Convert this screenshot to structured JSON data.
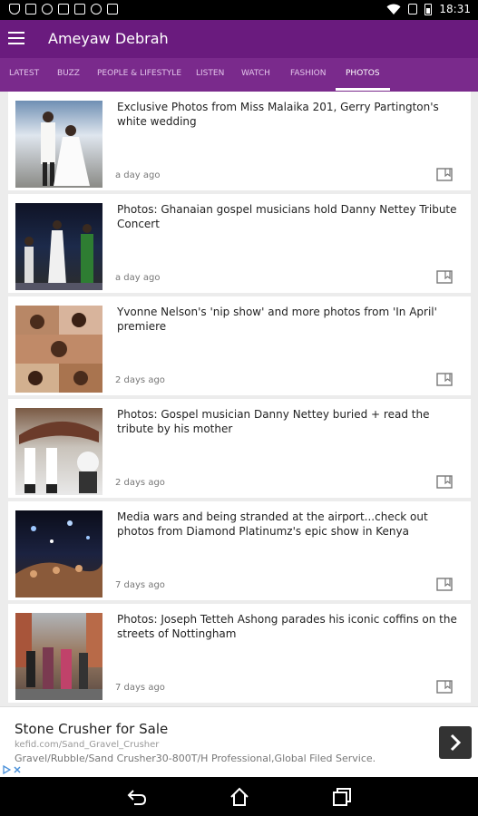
{
  "status_bar": {
    "time": "18:31"
  },
  "app": {
    "title": "Ameyaw Debrah"
  },
  "tabs": [
    {
      "label": "LATEST"
    },
    {
      "label": "BUZZ"
    },
    {
      "label": "PEOPLE & LIFESTYLE"
    },
    {
      "label": "LISTEN"
    },
    {
      "label": "WATCH"
    },
    {
      "label": "FASHION"
    },
    {
      "label": "PHOTOS",
      "active": true
    }
  ],
  "articles": [
    {
      "title": "Exclusive Photos from Miss Malaika 201, Gerry Partington's white wedding",
      "time": "a day ago"
    },
    {
      "title": "Photos: Ghanaian gospel musicians hold Danny Nettey Tribute Concert",
      "time": "a day ago"
    },
    {
      "title": "Yvonne Nelson's 'nip show' and more photos from 'In April' premiere",
      "time": "2 days ago"
    },
    {
      "title": "Photos: Gospel musician Danny Nettey buried + read the tribute by his mother",
      "time": "2 days ago"
    },
    {
      "title": "Media wars and being stranded at the airport...check out photos from Diamond Platinumz's epic show in Kenya",
      "time": "7 days ago"
    },
    {
      "title": "Photos: Joseph Tetteh Ashong parades his iconic coffins on the streets of Nottingham",
      "time": "7 days ago"
    }
  ],
  "ad": {
    "title": "Stone Crusher for Sale",
    "url": "kefid.com/Sand_Gravel_Crusher",
    "description": "Gravel/Rubble/Sand Crusher30-800T/H Professional,Global Filed Service."
  },
  "colors": {
    "primary": "#6a1b7e",
    "tabbar": "#7a2a8c"
  }
}
